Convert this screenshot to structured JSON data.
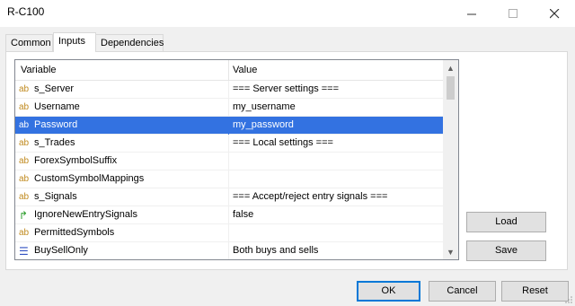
{
  "window": {
    "title": "R-C100",
    "minimize": "—",
    "maximize": "☐",
    "close": "✕"
  },
  "tabs": [
    {
      "label": "Common"
    },
    {
      "label": "Inputs"
    },
    {
      "label": "Dependencies"
    }
  ],
  "grid": {
    "headers": {
      "variable": "Variable",
      "value": "Value"
    },
    "rows": [
      {
        "icon": "ab",
        "name": "s_Server",
        "value": "=== Server settings ==="
      },
      {
        "icon": "ab",
        "name": "Username",
        "value": "my_username"
      },
      {
        "icon": "ab",
        "name": "Password",
        "value": "my_password"
      },
      {
        "icon": "ab",
        "name": "s_Trades",
        "value": "=== Local settings ==="
      },
      {
        "icon": "ab",
        "name": "ForexSymbolSuffix",
        "value": ""
      },
      {
        "icon": "ab",
        "name": "CustomSymbolMappings",
        "value": ""
      },
      {
        "icon": "ab",
        "name": "s_Signals",
        "value": "=== Accept/reject entry signals ==="
      },
      {
        "icon": "↱",
        "name": "IgnoreNewEntrySignals",
        "value": "false"
      },
      {
        "icon": "ab",
        "name": "PermittedSymbols",
        "value": ""
      },
      {
        "icon": "☰",
        "name": "BuySellOnly",
        "value": "Both buys and sells"
      }
    ],
    "scroll_up": "▲",
    "scroll_down": "▼"
  },
  "buttons": {
    "load": "Load",
    "save": "Save",
    "ok": "OK",
    "cancel": "Cancel",
    "reset": "Reset"
  }
}
